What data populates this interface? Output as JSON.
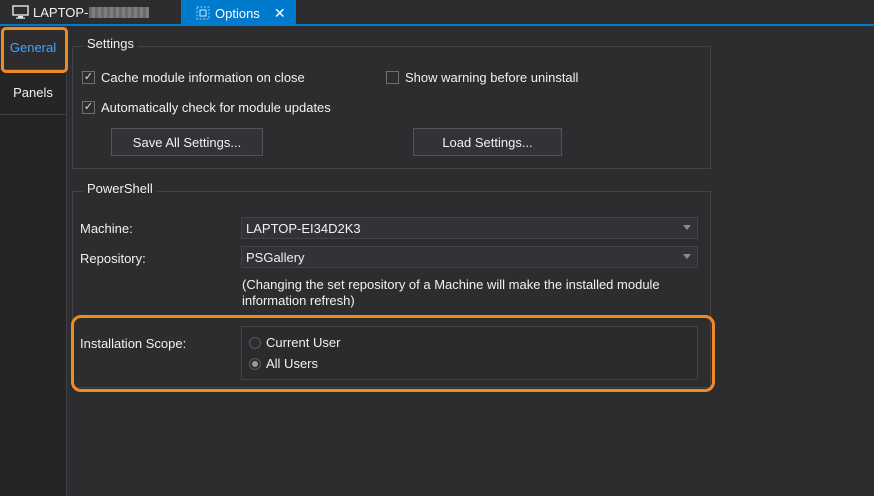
{
  "tabs": {
    "machine_tab_label": "LAPTOP-",
    "options_tab_label": "Options",
    "close_glyph": "✕"
  },
  "sidebar": {
    "items": [
      {
        "label": "General",
        "active": true
      },
      {
        "label": "Panels",
        "active": false
      }
    ]
  },
  "settings": {
    "title": "Settings",
    "cache_module_label": "Cache module information on close",
    "cache_module_checked": true,
    "show_warning_label": "Show warning before uninstall",
    "show_warning_checked": false,
    "auto_check_label": "Automatically check for module updates",
    "auto_check_checked": true,
    "save_all_label": "Save All Settings...",
    "load_label": "Load Settings..."
  },
  "powershell": {
    "title": "PowerShell",
    "machine_label": "Machine:",
    "machine_value": "LAPTOP-EI34D2K3",
    "repository_label": "Repository:",
    "repository_value": "PSGallery",
    "note_line1": "(Changing the set repository of a Machine will make the installed module",
    "note_line2": "information refresh)",
    "scope_label": "Installation Scope:",
    "scope_options": [
      {
        "label": "Current User",
        "selected": false
      },
      {
        "label": "All Users",
        "selected": true
      }
    ]
  },
  "colors": {
    "accent": "#007acc",
    "highlight": "#f08a24",
    "sidebar_active": "#3ea6ff"
  },
  "icons": {
    "machine_tab": "monitor-icon",
    "options_tab": "gear-icon",
    "close": "close-icon",
    "dropdown": "chevron-down-icon"
  }
}
